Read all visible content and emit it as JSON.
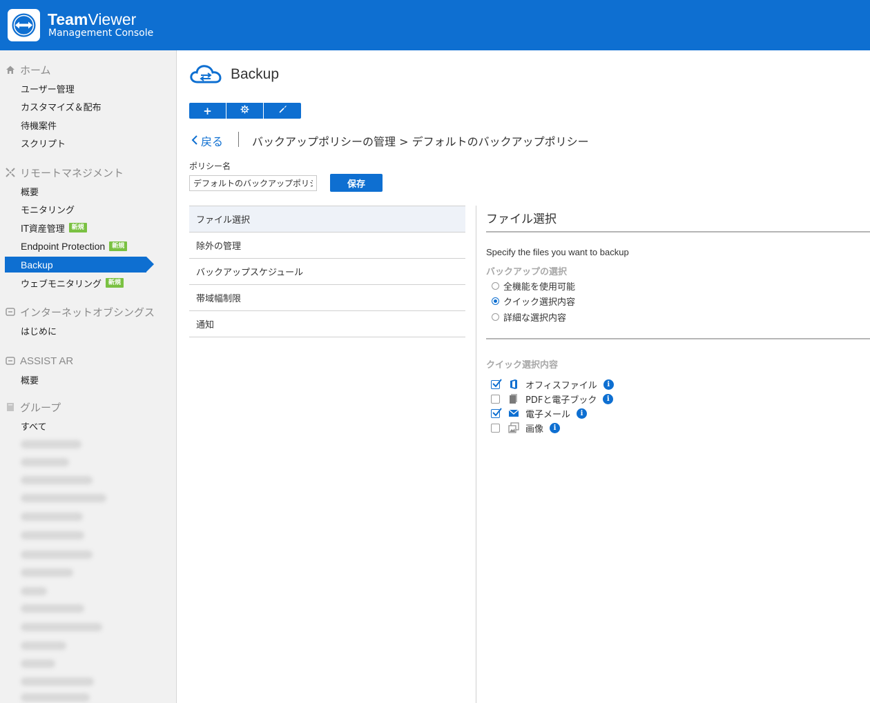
{
  "header": {
    "brand_bold": "Team",
    "brand_light": "Viewer",
    "subtitle": "Management Console"
  },
  "sidebar": {
    "sections": [
      {
        "title": "ホーム",
        "icon": "home-icon",
        "items": [
          "ユーザー管理",
          "カスタマイズ＆配布",
          "待機案件",
          "スクリプト"
        ]
      },
      {
        "title": "リモートマネジメント",
        "icon": "remote-management-icon",
        "items": [
          "概要",
          "モニタリング",
          "IT資産管理",
          "Endpoint Protection",
          "Backup",
          "ウェブモニタリング"
        ]
      },
      {
        "title": "インターネットオブシングス",
        "icon": "iot-icon",
        "items": [
          "はじめに"
        ]
      },
      {
        "title": "ASSIST AR",
        "icon": "assist-ar-icon",
        "items": [
          "概要"
        ]
      },
      {
        "title": "グループ",
        "icon": "group-icon",
        "items": [
          "すべて"
        ]
      }
    ],
    "badge_new": "新規",
    "active_item": "Backup"
  },
  "main": {
    "title": "Backup",
    "toolbar": {
      "add": "+",
      "settings_icon": "gear-icon",
      "tools_icon": "wrench-icon"
    },
    "back_label": "戻る",
    "breadcrumb": "バックアップポリシーの管理 > デフォルトのバックアップポリシー",
    "policy_label": "ポリシー名",
    "policy_value": "デフォルトのバックアップポリシー",
    "save_label": "保存",
    "menu": [
      "ファイル選択",
      "除外の管理",
      "バックアップスケジュール",
      "帯域幅制限",
      "通知"
    ]
  },
  "panel": {
    "title": "ファイル選択",
    "description": "Specify the files you want to backup",
    "backup_selection_heading": "バックアップの選択",
    "radios": [
      {
        "label": "全機能を使用可能",
        "selected": false
      },
      {
        "label": "クイック選択内容",
        "selected": true
      },
      {
        "label": "詳細な選択内容",
        "selected": false
      }
    ],
    "quick_heading": "クイック選択内容",
    "quick_items": [
      {
        "label": "オフィスファイル",
        "checked": true,
        "icon": "office-file-icon"
      },
      {
        "label": "PDFと電子ブック",
        "checked": false,
        "icon": "pdf-ebook-icon"
      },
      {
        "label": "電子メール",
        "checked": true,
        "icon": "email-icon"
      },
      {
        "label": "画像",
        "checked": false,
        "icon": "image-icon"
      }
    ],
    "info_glyph": "i"
  },
  "colors": {
    "brand_blue": "#0e6fd1",
    "badge_green": "#7ac142"
  }
}
